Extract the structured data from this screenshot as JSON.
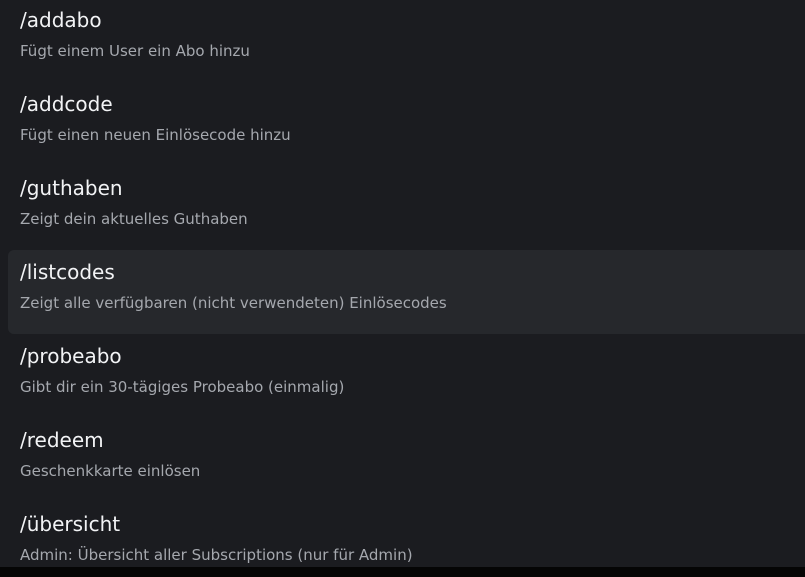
{
  "commands": [
    {
      "name": "/addabo",
      "description": "Fügt einem User ein Abo hinzu"
    },
    {
      "name": "/addcode",
      "description": "Fügt einen neuen Einlösecode hinzu"
    },
    {
      "name": "/guthaben",
      "description": "Zeigt dein aktuelles Guthaben"
    },
    {
      "name": "/listcodes",
      "description": "Zeigt alle verfügbaren (nicht verwendeten) Einlösecodes"
    },
    {
      "name": "/probeabo",
      "description": "Gibt dir ein 30-tägiges Probeabo (einmalig)"
    },
    {
      "name": "/redeem",
      "description": "Geschenkkarte einlösen"
    },
    {
      "name": "/übersicht",
      "description": "Admin: Übersicht aller Subscriptions (nur für Admin)"
    }
  ],
  "colors": {
    "background": "#1b1c20",
    "selected_background": "#26282c",
    "name_text": "#f2f3f5",
    "description_text": "#a5a8ae"
  }
}
